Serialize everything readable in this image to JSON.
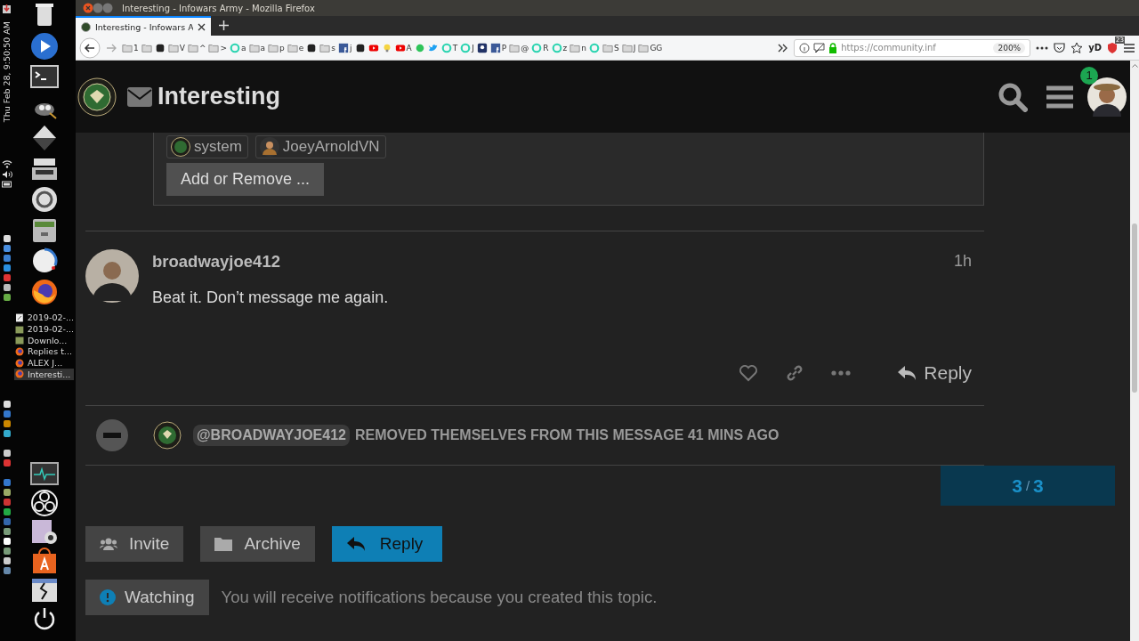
{
  "desktop": {
    "clock": "Thu Feb 28, 9:50:50 AM",
    "windows": [
      {
        "label": "2019-02-...",
        "kind": "document",
        "selected": false
      },
      {
        "label": "2019-02-...",
        "kind": "folder",
        "selected": false
      },
      {
        "label": "Downlo...",
        "kind": "folder",
        "selected": false
      },
      {
        "label": "Replies t...",
        "kind": "firefox",
        "selected": false
      },
      {
        "label": "ALEX J...",
        "kind": "firefox",
        "selected": false
      },
      {
        "label": "Interesti...",
        "kind": "firefox",
        "selected": true
      }
    ]
  },
  "browser": {
    "title": "Interesting - Infowars Army - Mozilla Firefox",
    "tab": {
      "title": "Interesting - Infowars A"
    },
    "bookmarks": [
      {
        "kind": "folder",
        "label": "1"
      },
      {
        "kind": "folder"
      },
      {
        "kind": "dark"
      },
      {
        "kind": "folder",
        "label": "V"
      },
      {
        "kind": "folder",
        "label": "^"
      },
      {
        "kind": "folder",
        "label": ">"
      },
      {
        "kind": "teal",
        "label": "a"
      },
      {
        "kind": "folder",
        "label": "a"
      },
      {
        "kind": "folder",
        "label": "p"
      },
      {
        "kind": "folder",
        "label": "e"
      },
      {
        "kind": "dark"
      },
      {
        "kind": "folder",
        "label": "s"
      },
      {
        "kind": "facebook",
        "label": "j"
      },
      {
        "kind": "dark"
      },
      {
        "kind": "youtube"
      },
      {
        "kind": "bulb"
      },
      {
        "kind": "youtube",
        "label": "A"
      },
      {
        "kind": "green"
      },
      {
        "kind": "twitter"
      },
      {
        "kind": "teal",
        "label": "T"
      },
      {
        "kind": "teal",
        "label": "J"
      },
      {
        "kind": "navy"
      },
      {
        "kind": "facebook",
        "label": "P"
      },
      {
        "kind": "folder",
        "label": "@"
      },
      {
        "kind": "teal",
        "label": "R"
      },
      {
        "kind": "teal",
        "label": "z"
      },
      {
        "kind": "folder",
        "label": "n"
      },
      {
        "kind": "teal"
      },
      {
        "kind": "folder",
        "label": "S"
      },
      {
        "kind": "folder",
        "label": "J"
      },
      {
        "kind": "folder",
        "label": "GG"
      }
    ],
    "url": "https://community.inf",
    "zoom": "200%",
    "extension_label": "yD",
    "extension_badge": "23"
  },
  "page": {
    "title": "Interesting",
    "notification_count": "1",
    "participants": [
      {
        "name": "system"
      },
      {
        "name": "JoeyArnoldVN"
      }
    ],
    "add_remove_button": "Add or Remove ...",
    "post": {
      "username": "broadwayjoe412",
      "time": "1h",
      "body": "Beat it. Don’t message me again.",
      "reply_label": "Reply"
    },
    "small_action": {
      "mention": "@BROADWAYJOE412",
      "text": "REMOVED THEMSELVES FROM THIS MESSAGE 41 MINS AGO"
    },
    "timeline": {
      "current": "3",
      "separator": "/",
      "total": "3",
      "level": 1
    },
    "buttons": [
      {
        "kind": "invite",
        "label": "Invite"
      },
      {
        "kind": "archive",
        "label": "Archive"
      },
      {
        "kind": "reply",
        "label": "Reply"
      }
    ],
    "notification": {
      "level": "Watching",
      "description": "You will receive notifications because you created this topic."
    }
  }
}
